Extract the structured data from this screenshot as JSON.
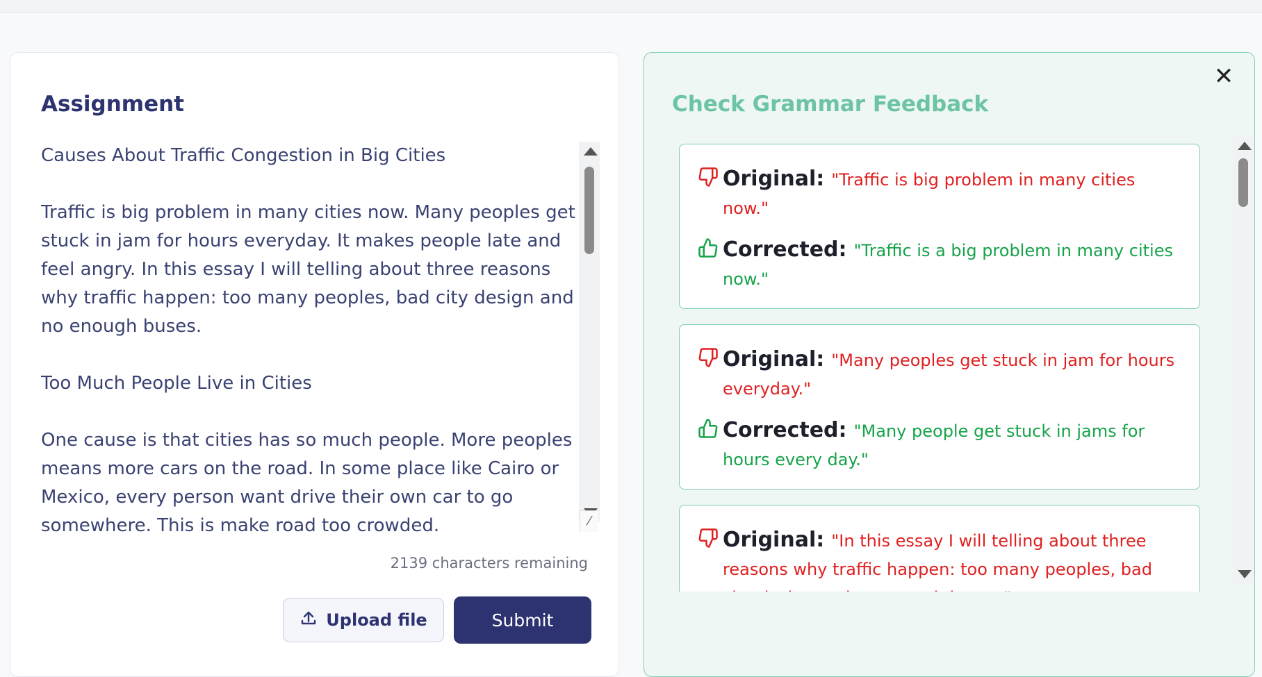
{
  "assignment": {
    "title": "Assignment",
    "essay": "Causes About Traffic Congestion in Big Cities\n\nTraffic is big problem in many cities now. Many peoples get stuck in jam for hours everyday. It makes people late and feel angry. In this essay I will telling about three reasons why traffic happen: too many peoples, bad city design and no enough buses.\n\nToo Much People Live in Cities\n\nOne cause is that cities has so much people. More peoples means more cars on the road. In some place like Cairo or Mexico, every person want drive their own car to go somewhere. This is make road too crowded.",
    "chars_remaining": "2139 characters remaining",
    "upload_label": "Upload file",
    "submit_label": "Submit"
  },
  "feedback": {
    "title": "Check Grammar Feedback",
    "close_icon": "close-icon",
    "original_label": "Original:",
    "corrected_label": "Corrected:",
    "items": [
      {
        "original": "\"Traffic is big problem in many cities now.\"",
        "corrected": "\"Traffic is a big problem in many cities now.\""
      },
      {
        "original": "\"Many peoples get stuck in jam for hours everyday.\"",
        "corrected": "\"Many people get stuck in jams for hours every day.\""
      },
      {
        "original": "\"In this essay I will telling about three reasons why traffic happen: too many peoples, bad city design and no enough buses.\"",
        "corrected": ""
      }
    ]
  },
  "colors": {
    "primary": "#2c3370",
    "accent_green": "#6cc4a4",
    "error_red": "#e02020",
    "success_green": "#16a34a"
  }
}
